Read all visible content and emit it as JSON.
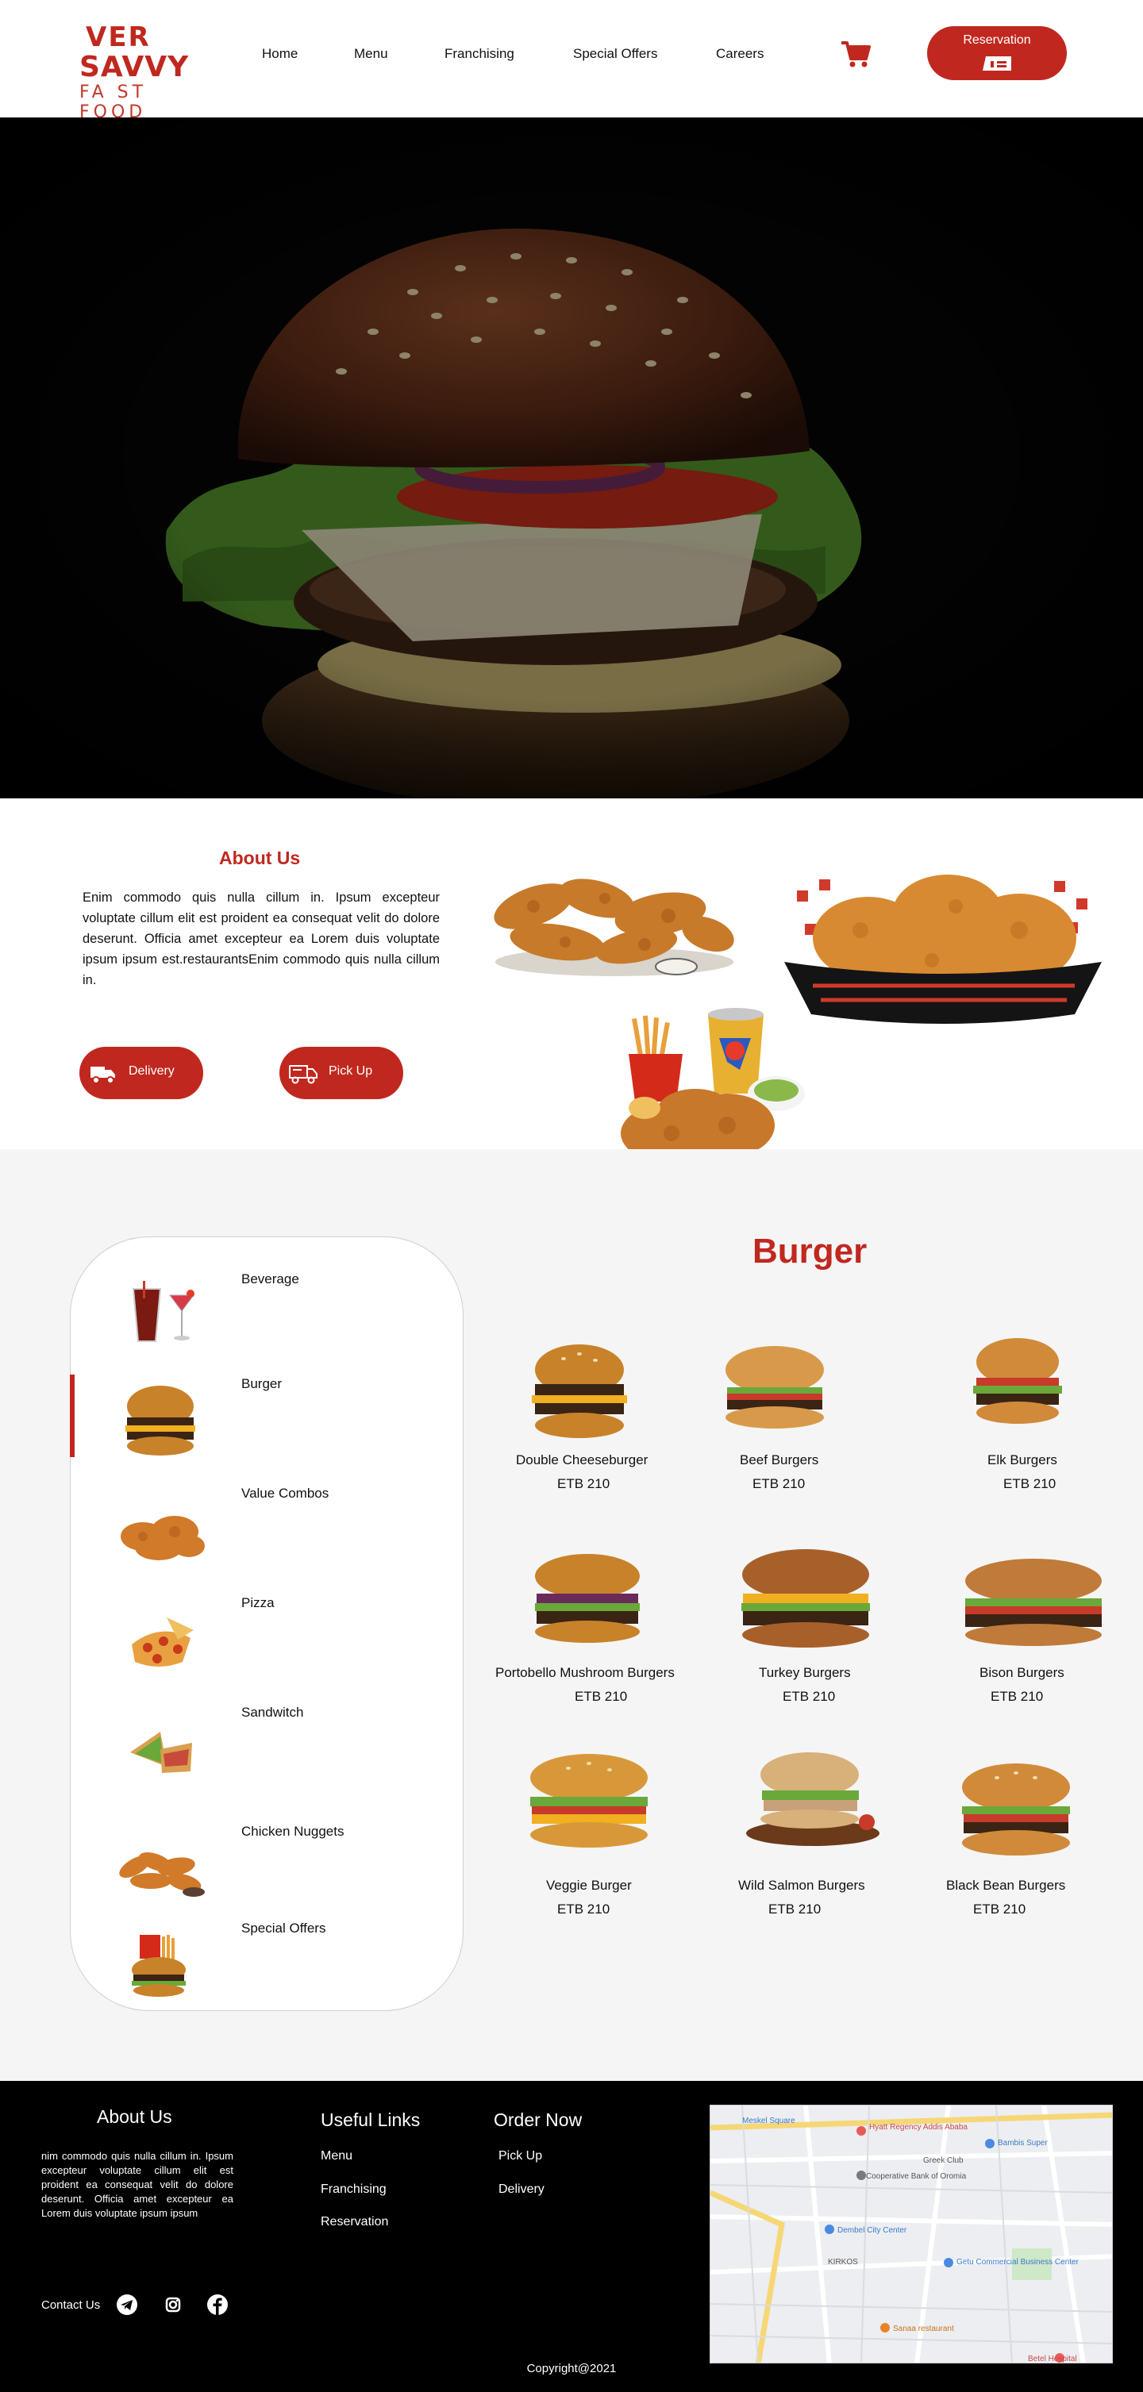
{
  "brand": {
    "logo_top": "VER SAVVY",
    "logo_sub": "FA ST FOOD",
    "accent": "#c0281f"
  },
  "nav": {
    "links": [
      "Home",
      "Menu",
      "Franchising",
      "Special Offers",
      "Careers"
    ],
    "cart_icon": "cart-icon",
    "reservation_label": "Reservation"
  },
  "about": {
    "title": "About  Us",
    "text": "Enim commodo quis nulla cillum in. Ipsum excepteur voluptate cillum elit est proident ea consequat velit do dolore deserunt. Officia amet excepteur ea Lorem duis voluptate ipsum ipsum est.restaurantsEnim commodo quis nulla cillum in.",
    "delivery_label": "Delivery",
    "pickup_label": "Pick Up"
  },
  "categories": {
    "items": [
      "Beverage",
      "Burger",
      "Value Combos",
      "Pizza",
      "Sandwitch",
      "Chicken Nuggets",
      "Special Offers"
    ],
    "active": "Burger"
  },
  "products": {
    "section_title": "Burger",
    "items": [
      {
        "name": "Double Cheeseburger",
        "price": "ETB 210"
      },
      {
        "name": "Beef Burgers",
        "price": "ETB 210"
      },
      {
        "name": "Elk Burgers",
        "price": "ETB 210"
      },
      {
        "name": "Portobello Mushroom Burgers",
        "price": "ETB 210"
      },
      {
        "name": "Turkey Burgers",
        "price": "ETB 210"
      },
      {
        "name": "Bison Burgers",
        "price": "ETB 210"
      },
      {
        "name": "Veggie Burger",
        "price": "ETB 210"
      },
      {
        "name": "Wild Salmon Burgers",
        "price": "ETB 210"
      },
      {
        "name": "Black Bean Burgers",
        "price": "ETB 210"
      }
    ]
  },
  "footer": {
    "about_title": "About Us",
    "about_text": "nim commodo quis nulla cillum in. Ipsum excepteur voluptate cillum elit est proident ea consequat velit do dolore deserunt. Officia amet excepteur ea Lorem duis voluptate ipsum ipsum",
    "links_title": "Useful Links",
    "links": [
      "Menu",
      "Franchising",
      "Reservation"
    ],
    "order_title": "Order Now",
    "order_links": [
      "Pick Up",
      "Delivery"
    ],
    "contact_label": "Contact Us",
    "copyright": "Copyright@2021"
  },
  "map": {
    "labels": [
      "Meskel Square",
      "Hyatt Regency Addis Ababa",
      "Cooperative Bank of Oromia",
      "Greek Club",
      "Bambis Super",
      "Dembel City Center",
      "Getu Commercial Business Center",
      "KIRKOS",
      "Sanaa restaurant",
      "Betel Hospital"
    ]
  }
}
